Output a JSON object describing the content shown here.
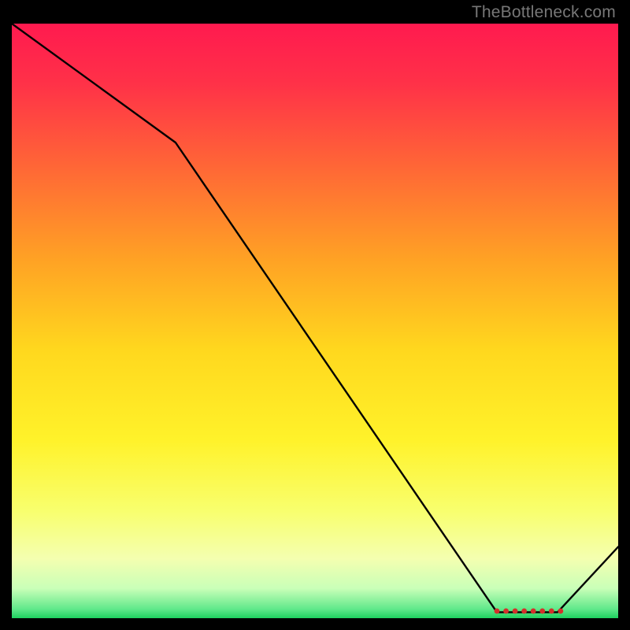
{
  "watermark": "TheBottleneck.com",
  "chart_data": {
    "type": "line",
    "title": "",
    "xlabel": "",
    "ylabel": "",
    "xlim": [
      0,
      100
    ],
    "ylim": [
      0,
      100
    ],
    "grid": false,
    "series": [
      {
        "name": "curve",
        "x": [
          0,
          27,
          80,
          90,
          100
        ],
        "values": [
          100,
          80,
          1,
          1,
          12
        ]
      }
    ],
    "markers": {
      "name": "red-dots",
      "x": [
        80,
        81.5,
        83,
        84.5,
        86,
        87.5,
        89,
        90.5
      ],
      "values": [
        1.2,
        1.2,
        1.2,
        1.2,
        1.2,
        1.2,
        1.2,
        1.2
      ]
    },
    "background": {
      "type": "vertical-gradient",
      "stops": [
        {
          "pos": 0.0,
          "color": "#ff1a4f"
        },
        {
          "pos": 0.1,
          "color": "#ff3148"
        },
        {
          "pos": 0.25,
          "color": "#ff6a35"
        },
        {
          "pos": 0.4,
          "color": "#ffa324"
        },
        {
          "pos": 0.55,
          "color": "#ffd81e"
        },
        {
          "pos": 0.7,
          "color": "#fff22a"
        },
        {
          "pos": 0.82,
          "color": "#f8ff6e"
        },
        {
          "pos": 0.9,
          "color": "#f4ffb0"
        },
        {
          "pos": 0.95,
          "color": "#c9ffb8"
        },
        {
          "pos": 0.985,
          "color": "#5fe88a"
        },
        {
          "pos": 1.0,
          "color": "#1ed15f"
        }
      ]
    }
  }
}
